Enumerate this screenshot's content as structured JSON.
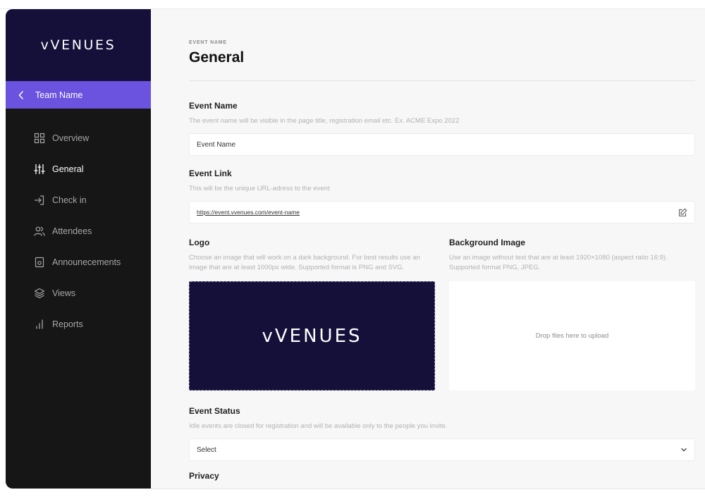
{
  "sidebar": {
    "brand": "vVENUES",
    "team": "Team Name",
    "items": [
      {
        "label": "Overview",
        "icon": "grid-icon",
        "active": false
      },
      {
        "label": "General",
        "icon": "sliders-icon",
        "active": true
      },
      {
        "label": "Check in",
        "icon": "login-icon",
        "active": false
      },
      {
        "label": "Attendees",
        "icon": "users-icon",
        "active": false
      },
      {
        "label": "Announecements",
        "icon": "announcement-icon",
        "active": false
      },
      {
        "label": "Views",
        "icon": "layers-icon",
        "active": false
      },
      {
        "label": "Reports",
        "icon": "bar-chart-icon",
        "active": false
      }
    ]
  },
  "header": {
    "eyebrow": "EVENT NAME",
    "title": "General"
  },
  "form": {
    "event_name": {
      "label": "Event Name",
      "help": "The event name will be visible in the page title, registration email etc. Ex. ACME Expo 2022",
      "value": "Event Name"
    },
    "event_link": {
      "label": "Event Link",
      "help": "This will be the unique URL-adress to the event",
      "value": "https://event.vvenues.com/event-name"
    },
    "logo": {
      "label": "Logo",
      "help": "Choose an image that will work on a dark background. For best results use an image that are at least 1000px wide. Supported format is PNG and SVG.",
      "preview": "vVENUES"
    },
    "background_image": {
      "label": "Background Image",
      "help": "Use an image without text that are at least 1920×1080 (aspect ratio 16:9). Supported format PNG, JPEG.",
      "drop_text": "Drop files here to upload"
    },
    "event_status": {
      "label": "Event Status",
      "help": "Idle events are closed for registration and will be available only to the people you invite.",
      "value": "Select"
    },
    "privacy": {
      "label": "Privacy"
    }
  },
  "colors": {
    "brand_dark": "#14103a",
    "accent": "#6c53df",
    "sidebar_bg": "#161616"
  }
}
